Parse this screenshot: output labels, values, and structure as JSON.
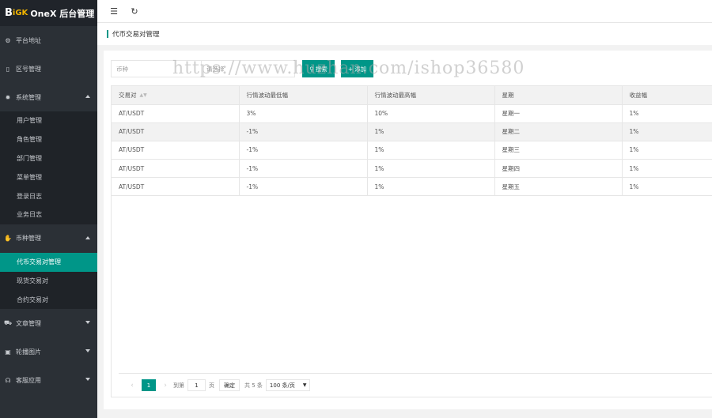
{
  "app": {
    "logo_b": "B",
    "logo_gk": "iGK",
    "logo_text": "OneX 后台管理"
  },
  "sidebar": {
    "items": [
      {
        "label": "平台地址",
        "icon": "gear-icon"
      },
      {
        "label": "区号管理",
        "icon": "phone-icon"
      },
      {
        "label": "系统管理",
        "icon": "settings-icon"
      },
      {
        "label": "币种管理",
        "icon": "hand-icon"
      },
      {
        "label": "文章管理",
        "icon": "car-icon"
      },
      {
        "label": "轮播图片",
        "icon": "image-icon"
      },
      {
        "label": "客服应用",
        "icon": "headset-icon"
      }
    ],
    "system_sub": [
      "用户管理",
      "角色管理",
      "部门管理",
      "菜单管理",
      "登录日志",
      "业务日志"
    ],
    "coin_sub": [
      "代币交易对管理",
      "现货交易对",
      "合约交易对"
    ]
  },
  "breadcrumb": {
    "title": "代币交易对管理"
  },
  "search": {
    "placeholder_coin": "币种",
    "placeholder_select": "请选择",
    "search_label": "搜索",
    "add_label": "添加"
  },
  "table": {
    "headers": [
      "交易对",
      "行情波动最低幅",
      "行情波动最高幅",
      "星期",
      "收益幅"
    ],
    "rows": [
      [
        "AT/USDT",
        "3%",
        "10%",
        "星期一",
        "1%"
      ],
      [
        "AT/USDT",
        "-1%",
        "1%",
        "星期二",
        "1%"
      ],
      [
        "AT/USDT",
        "-1%",
        "1%",
        "星期三",
        "1%"
      ],
      [
        "AT/USDT",
        "-1%",
        "1%",
        "星期四",
        "1%"
      ],
      [
        "AT/USDT",
        "-1%",
        "1%",
        "星期五",
        "1%"
      ]
    ]
  },
  "pager": {
    "current": "1",
    "goto_label": "到第",
    "page_value": "1",
    "page_unit": "页",
    "confirm_label": "确定",
    "total_label": "共 5 条",
    "page_size": "100 条/页"
  },
  "watermark": "https://www.huzhan.com/ishop36580",
  "colors": {
    "accent": "#009688",
    "sidebar_bg": "#2b3036"
  }
}
